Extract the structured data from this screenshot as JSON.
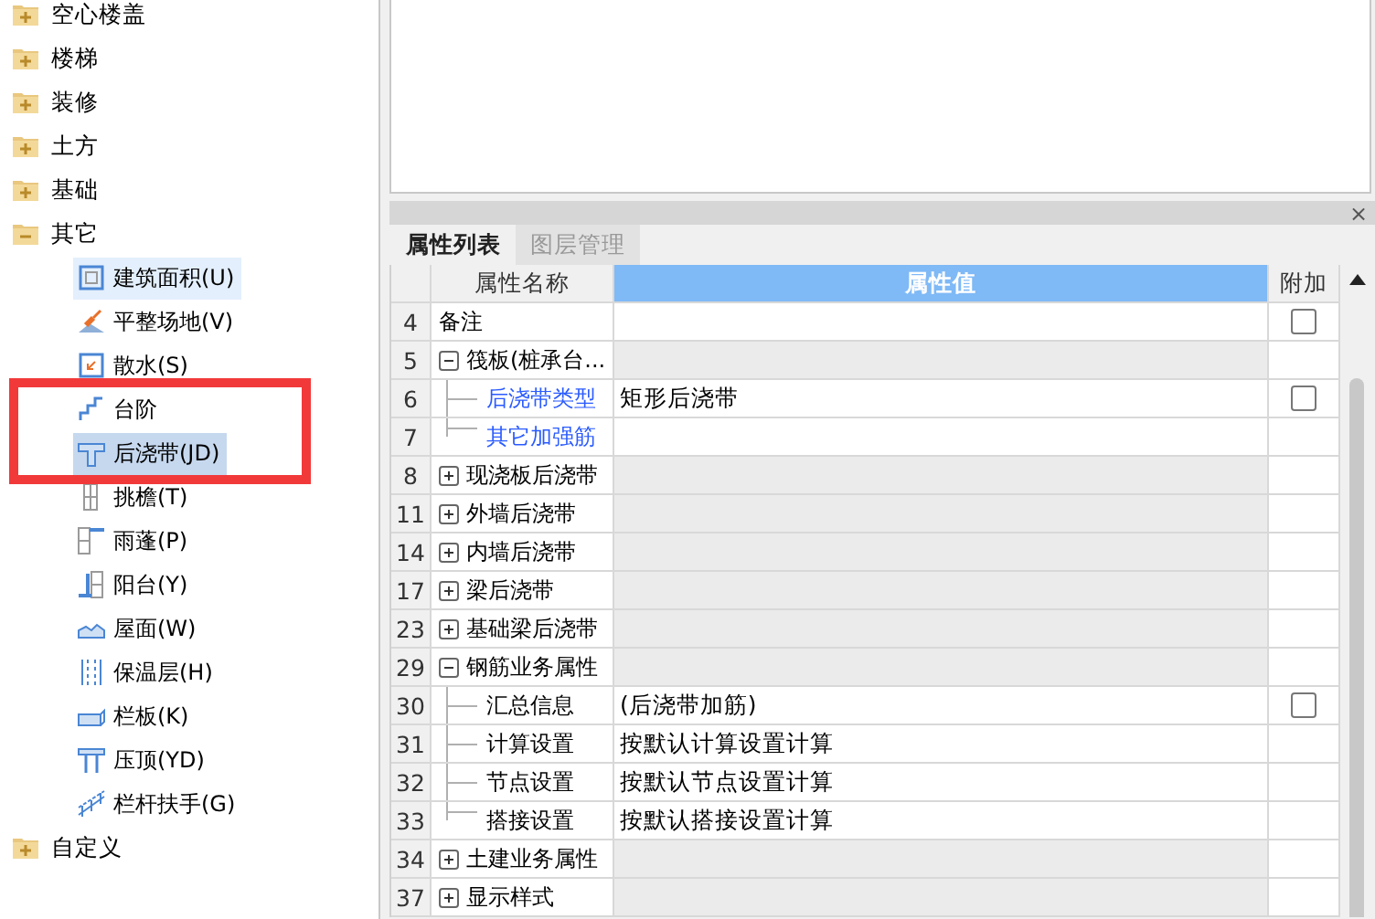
{
  "tree": {
    "items": [
      {
        "label": "空心楼盖",
        "expanded": false
      },
      {
        "label": "楼梯",
        "expanded": false
      },
      {
        "label": "装修",
        "expanded": false
      },
      {
        "label": "土方",
        "expanded": false
      },
      {
        "label": "基础",
        "expanded": false
      },
      {
        "label": "其它",
        "expanded": true,
        "children": [
          {
            "label": "建筑面积(U)",
            "selected": false,
            "hovered": true
          },
          {
            "label": "平整场地(V)",
            "selected": false,
            "hovered": false
          },
          {
            "label": "散水(S)",
            "selected": false,
            "hovered": false
          },
          {
            "label": "台阶",
            "selected": false,
            "hovered": false
          },
          {
            "label": "后浇带(JD)",
            "selected": true,
            "hovered": false
          },
          {
            "label": "挑檐(T)",
            "selected": false,
            "hovered": false
          },
          {
            "label": "雨蓬(P)",
            "selected": false,
            "hovered": false
          },
          {
            "label": "阳台(Y)",
            "selected": false,
            "hovered": false
          },
          {
            "label": "屋面(W)",
            "selected": false,
            "hovered": false
          },
          {
            "label": "保温层(H)",
            "selected": false,
            "hovered": false
          },
          {
            "label": "栏板(K)",
            "selected": false,
            "hovered": false
          },
          {
            "label": "压顶(YD)",
            "selected": false,
            "hovered": false
          },
          {
            "label": "栏杆扶手(G)",
            "selected": false,
            "hovered": false
          }
        ]
      },
      {
        "label": "自定义",
        "expanded": false
      }
    ]
  },
  "panel": {
    "close": "×",
    "tabs": [
      {
        "label": "属性列表",
        "selected": true
      },
      {
        "label": "图层管理",
        "selected": false
      }
    ],
    "columns": [
      "属性名称",
      "属性值",
      "附加"
    ],
    "rows": [
      {
        "number": "4",
        "kind": "plain",
        "name": "备注",
        "value": "",
        "checkbox": {
          "checked": false
        }
      },
      {
        "number": "5",
        "kind": "group",
        "expanded": true,
        "name": "筏板(桩承台..."
      },
      {
        "number": "6",
        "kind": "child",
        "name": "后浇带类型",
        "color": "#2a5bff",
        "value": "矩形后浇带",
        "checkbox": {
          "checked": false
        }
      },
      {
        "number": "7",
        "kind": "child",
        "last": true,
        "name": "其它加强筋",
        "color": "#2a5bff",
        "value": ""
      },
      {
        "number": "8",
        "kind": "group",
        "expanded": false,
        "name": "现浇板后浇带"
      },
      {
        "number": "11",
        "kind": "group",
        "expanded": false,
        "name": "外墙后浇带"
      },
      {
        "number": "14",
        "kind": "group",
        "expanded": false,
        "name": "内墙后浇带"
      },
      {
        "number": "17",
        "kind": "group",
        "expanded": false,
        "name": "梁后浇带"
      },
      {
        "number": "23",
        "kind": "group",
        "expanded": false,
        "name": "基础梁后浇带"
      },
      {
        "number": "29",
        "kind": "group",
        "expanded": true,
        "name": "钢筋业务属性"
      },
      {
        "number": "30",
        "kind": "child",
        "name": "汇总信息",
        "color": "#000000",
        "value": "(后浇带加筋)",
        "checkbox": {
          "checked": false
        }
      },
      {
        "number": "31",
        "kind": "child",
        "name": "计算设置",
        "color": "#000000",
        "value": "按默认计算设置计算"
      },
      {
        "number": "32",
        "kind": "child",
        "name": "节点设置",
        "color": "#000000",
        "value": "按默认节点设置计算"
      },
      {
        "number": "33",
        "kind": "child",
        "last": true,
        "name": "搭接设置",
        "color": "#000000",
        "value": "按默认搭接设置计算"
      },
      {
        "number": "34",
        "kind": "group",
        "expanded": false,
        "name": "土建业务属性"
      },
      {
        "number": "37",
        "kind": "group",
        "expanded": false,
        "name": "显示样式"
      }
    ]
  }
}
